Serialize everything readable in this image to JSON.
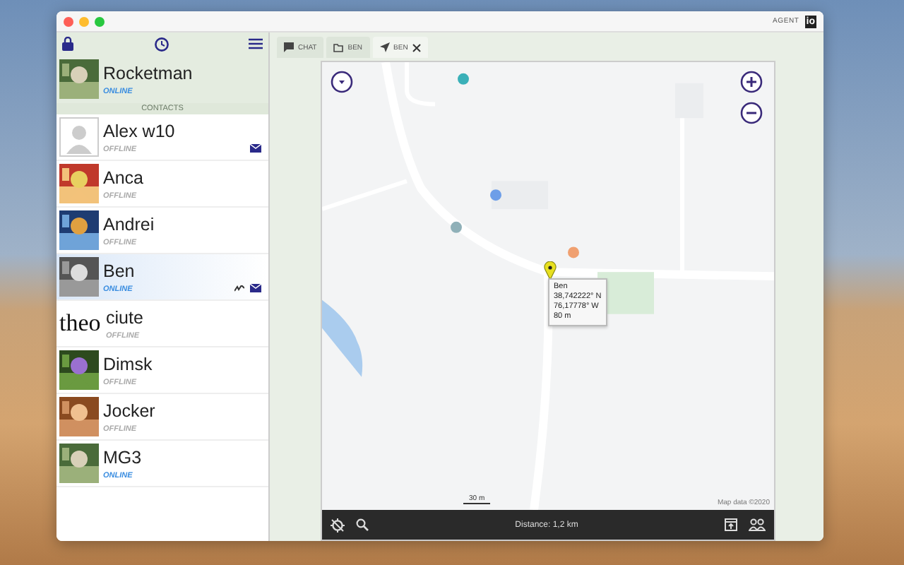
{
  "window": {
    "brand": "AGENT",
    "brand_mark": "io"
  },
  "sidebar": {
    "me": {
      "name": "Rocketman",
      "status": "ONLINE",
      "online": true
    },
    "section": "CONTACTS",
    "contacts": [
      {
        "name": "Alex w10",
        "status": "OFFLINE",
        "online": false,
        "avatar": {
          "kind": "silhouette"
        },
        "unread": true,
        "tracked": false,
        "selected": false
      },
      {
        "name": "Anca",
        "status": "OFFLINE",
        "online": false,
        "unread": false,
        "tracked": false,
        "selected": false
      },
      {
        "name": "Andrei",
        "status": "OFFLINE",
        "online": false,
        "unread": false,
        "tracked": false,
        "selected": false
      },
      {
        "name": "Ben",
        "status": "ONLINE",
        "online": true,
        "unread": true,
        "tracked": true,
        "selected": true
      },
      {
        "name": "ciute",
        "status": "OFFLINE",
        "online": false,
        "avatar": {
          "kind": "text",
          "text": "theo"
        },
        "unread": false,
        "tracked": false,
        "selected": false
      },
      {
        "name": "Dimsk",
        "status": "OFFLINE",
        "online": false,
        "unread": false,
        "tracked": false,
        "selected": false
      },
      {
        "name": "Jocker",
        "status": "OFFLINE",
        "online": false,
        "unread": false,
        "tracked": false,
        "selected": false
      },
      {
        "name": "MG3",
        "status": "ONLINE",
        "online": true,
        "unread": false,
        "tracked": false,
        "selected": false
      }
    ]
  },
  "tabs": [
    {
      "kind": "chat",
      "label": "CHAT",
      "selected": false,
      "closable": false
    },
    {
      "kind": "folder",
      "label": "BEN",
      "selected": false,
      "closable": false
    },
    {
      "kind": "location",
      "label": "BEN",
      "selected": true,
      "closable": true
    }
  ],
  "map": {
    "marker": {
      "lines": [
        "Ben",
        "38,742222° N",
        "76,17778° W",
        "80 m"
      ]
    },
    "scale": "30 m",
    "attribution": "Map data ©2020"
  },
  "bottom_bar": {
    "distance": "Distance: 1,2 km"
  }
}
